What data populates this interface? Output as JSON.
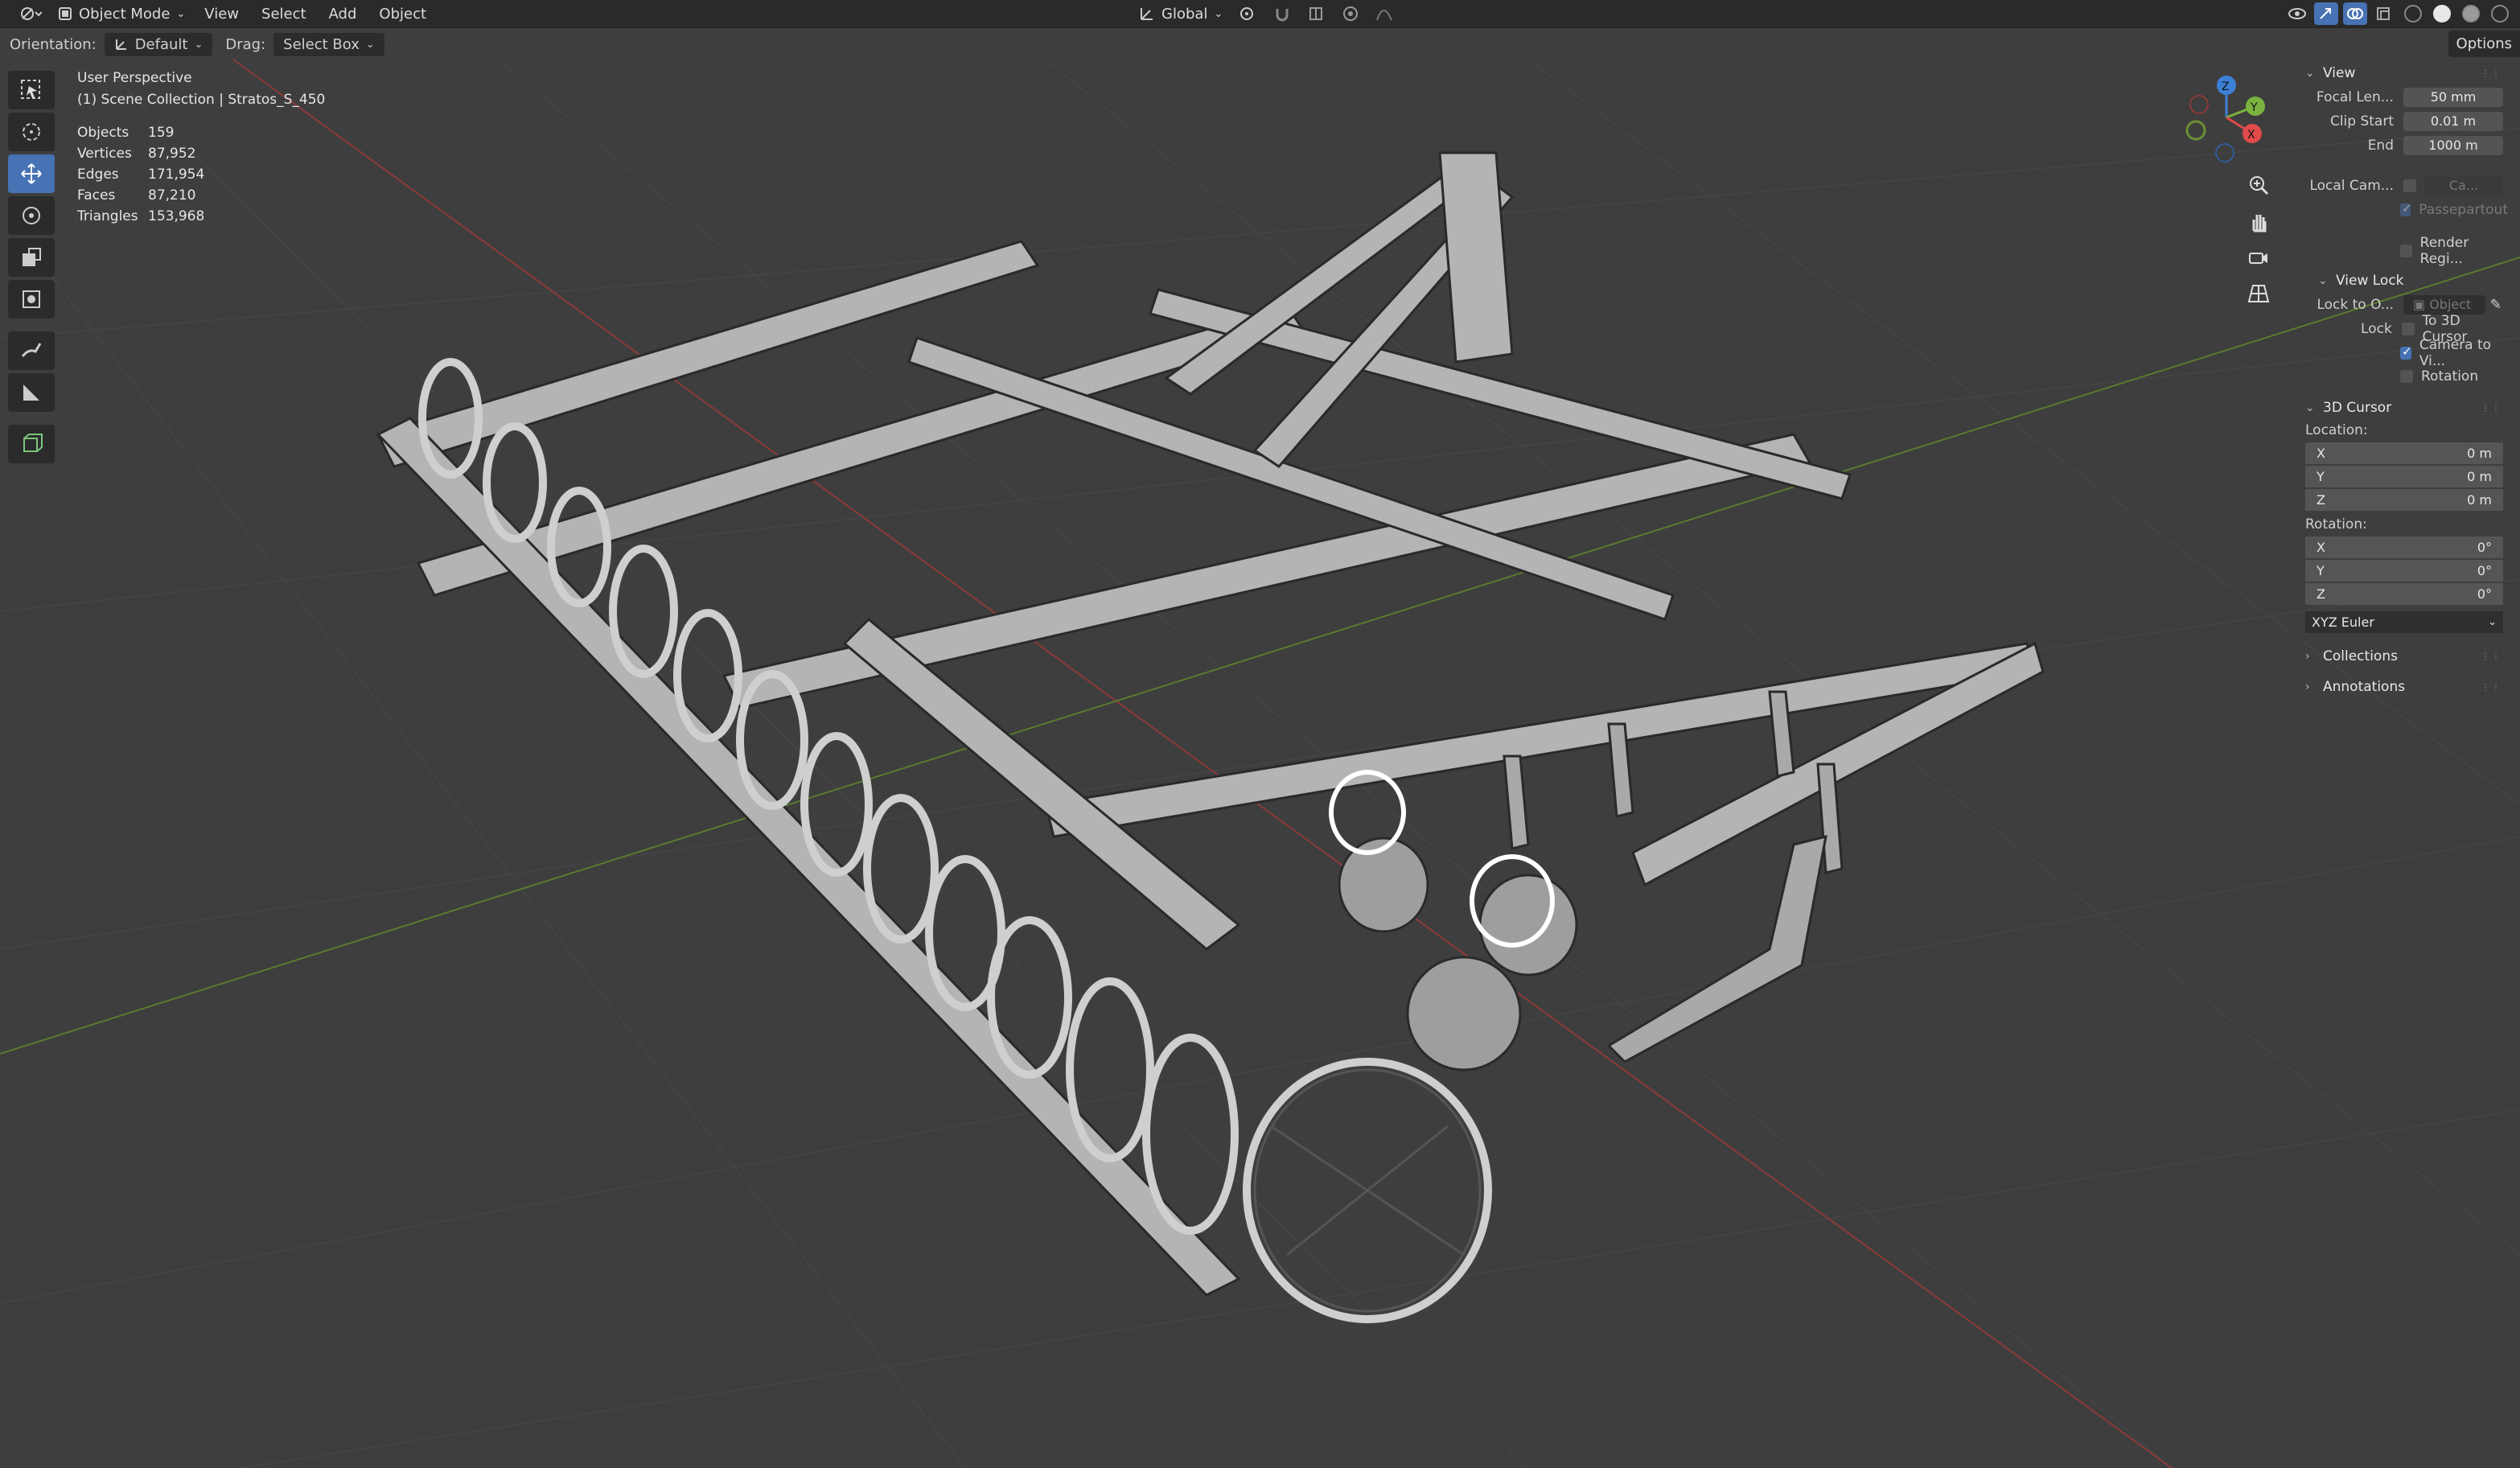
{
  "header": {
    "editor_icon": "editor-type-icon",
    "mode": "Object Mode",
    "menus": [
      "View",
      "Select",
      "Add",
      "Object"
    ],
    "transform_orientation": "Global"
  },
  "tool_settings": {
    "orientation_label": "Orientation:",
    "orientation_value": "Default",
    "drag_label": "Drag:",
    "drag_value": "Select Box",
    "options": "Options"
  },
  "overlay": {
    "view_name": "User Perspective",
    "collection": "(1) Scene Collection | Stratos_S_450",
    "stats": [
      {
        "label": "Objects",
        "value": "159"
      },
      {
        "label": "Vertices",
        "value": "87,952"
      },
      {
        "label": "Edges",
        "value": "171,954"
      },
      {
        "label": "Faces",
        "value": "87,210"
      },
      {
        "label": "Triangles",
        "value": "153,968"
      }
    ]
  },
  "gizmo": {
    "x": "X",
    "y": "Y",
    "z": "Z"
  },
  "sidebar": {
    "view": {
      "title": "View",
      "focal_label": "Focal Len...",
      "focal_value": "50 mm",
      "clip_start_label": "Clip Start",
      "clip_start_value": "0.01 m",
      "end_label": "End",
      "end_value": "1000 m",
      "local_cam_label": "Local Cam...",
      "local_cam_value": "Ca...",
      "passepartout": "Passepartout",
      "render_region": "Render Regi..."
    },
    "view_lock": {
      "title": "View Lock",
      "lock_to_label": "Lock to O...",
      "lock_to_value": "Object",
      "lock_label": "Lock",
      "to_cursor": "To 3D Cursor",
      "camera_to_view": "Camera to Vi...",
      "rotation": "Rotation"
    },
    "cursor": {
      "title": "3D Cursor",
      "location_label": "Location:",
      "location": [
        {
          "axis": "X",
          "value": "0 m"
        },
        {
          "axis": "Y",
          "value": "0 m"
        },
        {
          "axis": "Z",
          "value": "0 m"
        }
      ],
      "rotation_label": "Rotation:",
      "rotation": [
        {
          "axis": "X",
          "value": "0°"
        },
        {
          "axis": "Y",
          "value": "0°"
        },
        {
          "axis": "Z",
          "value": "0°"
        }
      ],
      "rotation_mode": "XYZ Euler"
    },
    "collections_title": "Collections",
    "annotations_title": "Annotations"
  },
  "colors": {
    "accent": "#4772b3",
    "x_axis": "#e04a4a",
    "y_axis": "#7ab33f",
    "z_axis": "#3c7fd6",
    "model": "#b9b9b9"
  }
}
